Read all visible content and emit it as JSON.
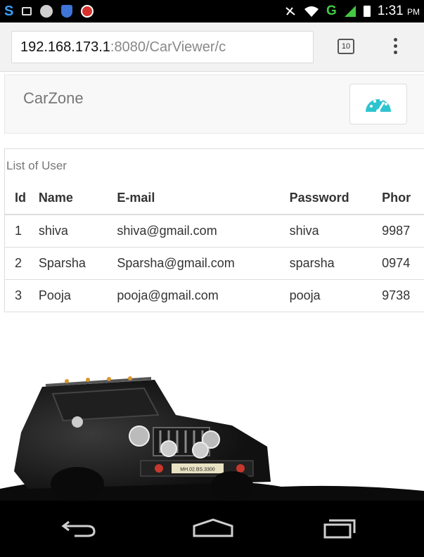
{
  "status_bar": {
    "time": "1:31",
    "ampm": "PM",
    "network": "G",
    "icons": [
      "s-icon",
      "image-icon",
      "ball-icon",
      "shield-icon",
      "red-app-icon",
      "mute-icon",
      "wifi-icon",
      "signal-icon",
      "battery-icon"
    ]
  },
  "browser": {
    "url_host": "192.168.173.1",
    "url_path": ":8080/CarViewer/c",
    "tab_count": "10"
  },
  "navbar": {
    "brand": "CarZone",
    "accent": "#2ec4cf"
  },
  "users": {
    "caption": "List of User",
    "columns": [
      "Id",
      "Name",
      "E-mail",
      "Password",
      "Phor"
    ],
    "rows": [
      [
        "1",
        "shiva",
        "shiva@gmail.com",
        "shiva",
        "9987"
      ],
      [
        "2",
        "Sparsha",
        "Sparsha@gmail.com",
        "sparsha",
        "0974"
      ],
      [
        "3",
        "Pooja",
        "pooja@gmail.com",
        "pooja",
        "9738"
      ]
    ]
  },
  "hero": {
    "plate": "MH.02.BS.3300"
  }
}
